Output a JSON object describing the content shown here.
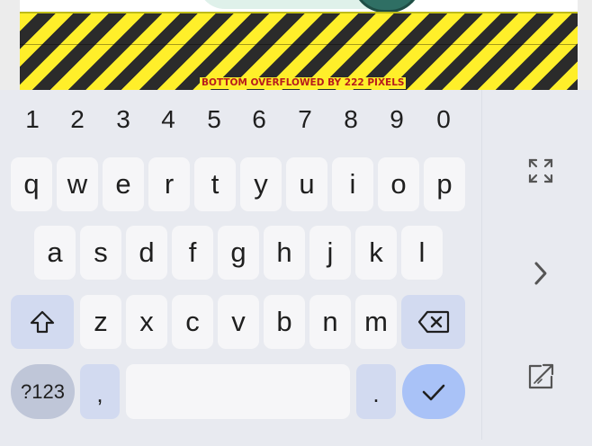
{
  "overflow_warning": {
    "text": "BOTTOM OVERFLOWED BY 222 PIXELS",
    "colors": {
      "stripe_yellow": "#ffef2a",
      "stripe_dark": "#2b2b2b",
      "text": "#b71c1c"
    }
  },
  "keyboard": {
    "number_row": [
      "1",
      "2",
      "3",
      "4",
      "5",
      "6",
      "7",
      "8",
      "9",
      "0"
    ],
    "row1": [
      "q",
      "w",
      "e",
      "r",
      "t",
      "y",
      "u",
      "i",
      "o",
      "p"
    ],
    "row2": [
      "a",
      "s",
      "d",
      "f",
      "g",
      "h",
      "j",
      "k",
      "l"
    ],
    "row3": [
      "z",
      "x",
      "c",
      "v",
      "b",
      "n",
      "m"
    ],
    "symbols_key": "?123",
    "comma_key": ",",
    "period_key": ".",
    "icons": {
      "shift": "shift-icon",
      "backspace": "backspace-icon",
      "done": "checkmark-icon"
    },
    "colors": {
      "background": "#e8eaf0",
      "key": "#f6f6f8",
      "special_key": "#d2daf0",
      "symbols_key": "#bfc6d8",
      "done_key": "#a9c2f7"
    }
  },
  "side_panel": {
    "icons": [
      "fullscreen-icon",
      "chevron-right-icon",
      "open-external-icon"
    ]
  }
}
